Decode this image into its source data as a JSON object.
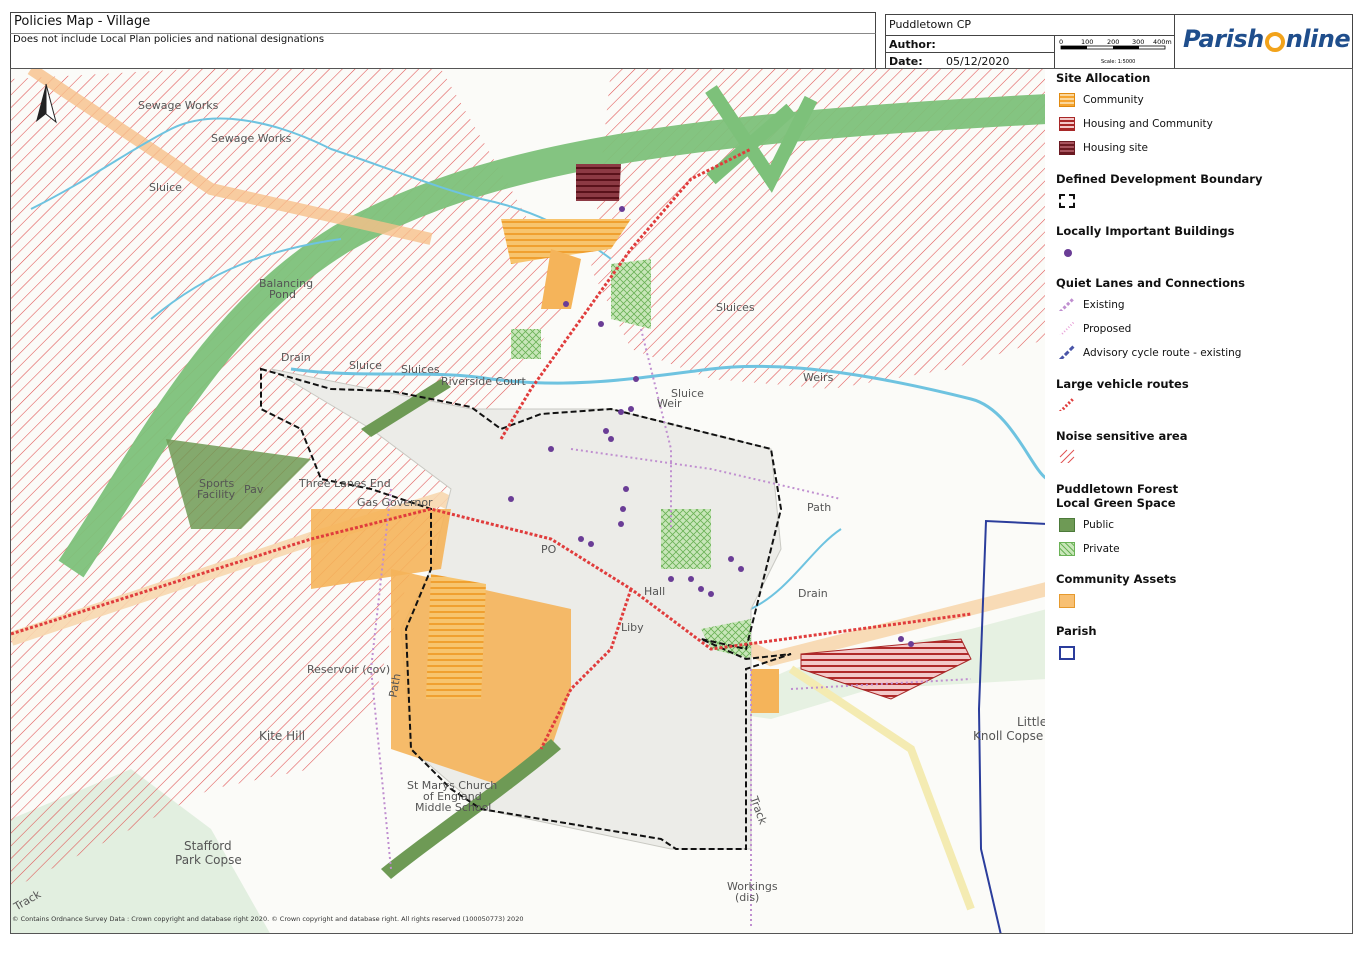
{
  "header": {
    "title": "Policies Map - Village",
    "subtitle": "Does not include Local Plan policies and national designations",
    "parish": "Puddletown CP",
    "author_label": "Author:",
    "author_value": "",
    "date_label": "Date:",
    "date_value": "05/12/2020",
    "scale_ticks": [
      "0",
      "100",
      "200",
      "300",
      "400m"
    ],
    "scale_text": "Scale: 1:5000",
    "logo_left": "Parish",
    "logo_right": "nline"
  },
  "legend": {
    "site_allocation": "Site Allocation",
    "community": "Community",
    "housing_and_community": "Housing and Community",
    "housing_site": "Housing site",
    "ddb": "Defined Development Boundary",
    "lib": "Locally Important Buildings",
    "quiet_lanes": "Quiet Lanes and Connections",
    "existing": "Existing",
    "proposed": "Proposed",
    "cycle": "Advisory cycle route - existing",
    "large_vehicle": "Large vehicle routes",
    "noise": "Noise sensitive area",
    "lgs_title_1": "Puddletown Forest",
    "lgs_title_2": "Local Green Space",
    "public": "Public",
    "private": "Private",
    "community_assets": "Community Assets",
    "parish": "Parish"
  },
  "map": {
    "labels": {
      "sewage1": "Sewage Works",
      "sewage2": "Sewage Works",
      "sluice1": "Sluice",
      "balancing": "Balancing",
      "pond": "Pond",
      "drain1": "Drain",
      "sluice2": "Sluice",
      "sluices1": "Sluices",
      "riverside": "Riverside Court",
      "sports": "Sports",
      "facility": "Facility",
      "pav": "Pav",
      "three_lanes": "Three Lanes End",
      "gas": "Gas Governor",
      "po": "PO",
      "hall": "Hall",
      "liby": "Liby",
      "reservoir": "Reservoir (cov)",
      "kite": "Kite Hill",
      "st_marys1": "St Marys Church",
      "st_marys2": "of England",
      "st_marys3": "Middle School",
      "stafford1": "Stafford",
      "stafford2": "Park Copse",
      "sluices2": "Sluices",
      "weirs": "Weirs",
      "sluice3": "Sluice",
      "weir": "Weir",
      "path1": "Path",
      "drain2": "Drain",
      "little": "Little",
      "knoll": "Knoll Copse",
      "workings1": "Workings",
      "workings2": "(dis)",
      "track1": "Track",
      "track2": "Track",
      "path2": "Path"
    },
    "copyright": "© Contains Ordnance Survey Data : Crown copyright and database right 2020. © Crown copyright and database right. All rights reserved (100050773) 2020"
  },
  "colors": {
    "community": "#f5a531",
    "housing_community": "#a82828",
    "housing_site": "#6b1a22",
    "lgs_public": "#6e9a55",
    "lgs_private": "#8cc47a",
    "noise": "#e04040",
    "parish": "#2b3d9c",
    "river": "#6ec3e0",
    "road_major": "#7dc17a"
  }
}
